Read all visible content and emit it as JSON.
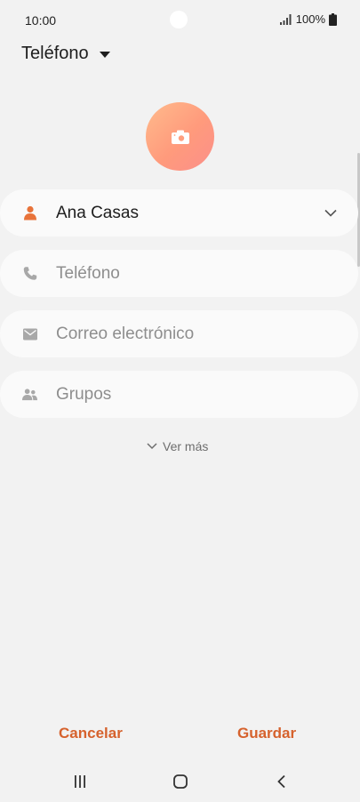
{
  "status_bar": {
    "time": "10:00",
    "battery": "100%"
  },
  "account": {
    "label": "Teléfono"
  },
  "fields": {
    "name": {
      "value": "Ana Casas",
      "icon": "person-icon"
    },
    "phone": {
      "placeholder": "Teléfono",
      "icon": "phone-icon"
    },
    "email": {
      "placeholder": "Correo electrónico",
      "icon": "mail-icon"
    },
    "groups": {
      "placeholder": "Grupos",
      "icon": "groups-icon"
    }
  },
  "more": {
    "label": "Ver más"
  },
  "actions": {
    "cancel": "Cancelar",
    "save": "Guardar"
  },
  "colors": {
    "accent": "#d6622d",
    "avatar_gradient_start": "#ffbb8c",
    "avatar_gradient_end": "#fb8f8a",
    "background": "#f2f2f2",
    "field_background": "#fafafa"
  }
}
